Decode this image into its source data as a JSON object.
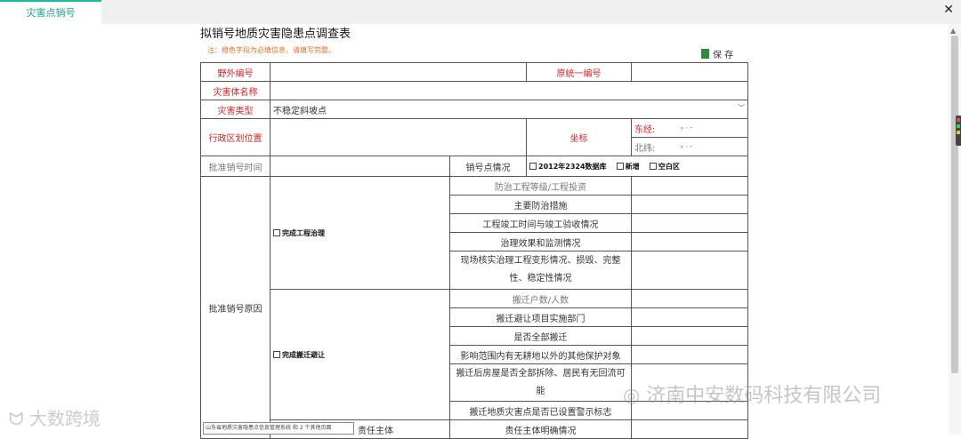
{
  "tab": {
    "label": "灾害点销号"
  },
  "document": {
    "title": "拟销号地质灾害隐患点调查表",
    "note": "注：橙色字段为必填信息，请填写完整。",
    "save_label": "保 存"
  },
  "form": {
    "field_no": "野外编号",
    "unified_no": "原统一编号",
    "hazard_name": "灾害体名称",
    "hazard_type_label": "灾害类型",
    "hazard_type_value": "不稳定斜坡点",
    "admin_location": "行政区划位置",
    "coordinates": "坐标",
    "east_label": "东经:",
    "north_label": "北纬:",
    "dms_format": "°        ′        ″",
    "approval_time": "批准销号时间",
    "cancel_status": "销号点情况",
    "opt_2012": "2012年2324数据库",
    "opt_new": "新增",
    "opt_blank": "空白区",
    "approval_reason": "批准销号原因",
    "complete_treatment": "完成工程治理",
    "complete_relocation": "完成搬迁避让",
    "responsible_partial": "责任主体",
    "treatment_rows": [
      "防治工程等级/工程投资",
      "主要防治措施",
      "工程竣工时间与竣工验收情况",
      "治理效果和监测情况",
      "现场核实治理工程变形情况、损毁、完整性、稳定性情况"
    ],
    "relocation_rows": [
      "搬迁户数/人数",
      "搬迁避让项目实施部门",
      "是否全部搬迁",
      "影响范围内有无耕地以外的其他保护对象",
      "搬迁后房屋是否全部拆除、居民有无回流可能",
      "搬迁地质灾害点是否已设置警示标志",
      "责任主体明确情况"
    ]
  },
  "overlay": {
    "tooltip": "山东省地质灾害隐患点信息管理系统 和 2 个其他页面",
    "watermark_company": "济南中安数码科技有限公司",
    "watermark_brand": "大数跨境"
  },
  "colors": {
    "accent": "#1abc9c",
    "required": "#e02020",
    "note": "#e8712b"
  }
}
